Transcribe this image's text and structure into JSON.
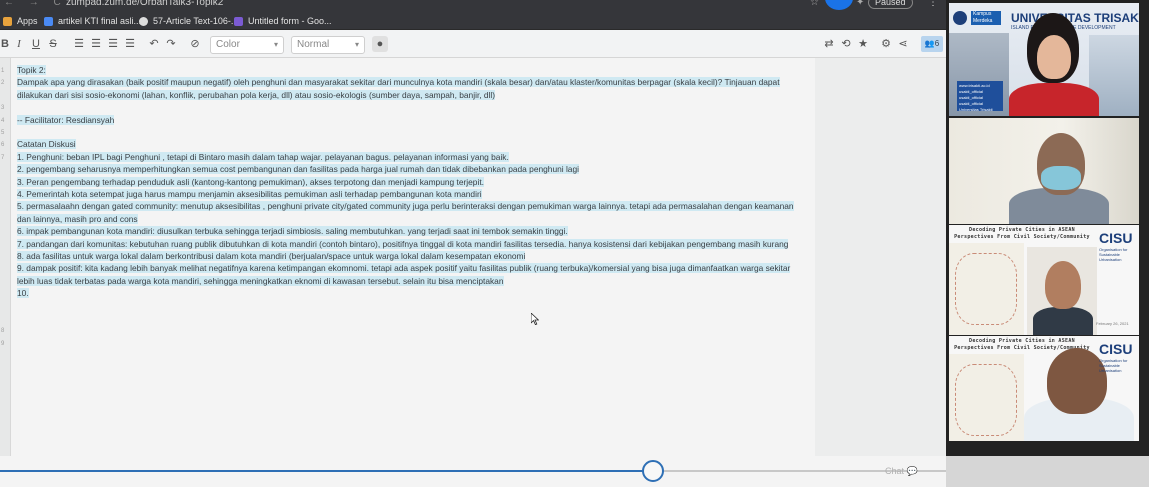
{
  "browser": {
    "url": "zumpad.zum.de/OrbanTalk3-Topik2",
    "paused_label": "Paused",
    "bookmarks": [
      {
        "label": "Apps",
        "icon": "apps-grid-icon",
        "color": "#e8a33d"
      },
      {
        "label": "artikel KTI final asli...",
        "icon": "doc-icon",
        "color": "#4a8af4"
      },
      {
        "label": "57-Article Text-106-...",
        "icon": "globe-icon",
        "color": "#dddddd"
      },
      {
        "label": "Untitled form - Goo...",
        "icon": "form-icon",
        "color": "#7b5bd3"
      }
    ]
  },
  "toolbar": {
    "bold": "B",
    "italic": "I",
    "underline": "U",
    "strike": "S",
    "color_select": "Color",
    "style_select": "Normal",
    "users_count": "6"
  },
  "editor": {
    "line_numbers": [
      "1",
      "2",
      "",
      "3",
      "4",
      "5",
      "6",
      "7",
      "",
      "",
      "",
      "",
      "",
      "",
      "",
      "",
      "",
      "",
      "",
      "",
      "",
      "8",
      "9"
    ],
    "lines": [
      {
        "text": "Topik 2:",
        "hl": true
      },
      {
        "text": "Dampak apa yang dirasakan (baik positif maupun negatif) oleh penghuni dan masyarakat sekitar dari munculnya kota mandiri (skala besar) dan/atau klaster/komunitas berpagar (skala kecil)? Tinjauan dapat dilakukan dari sisi sosio-ekonomi (lahan, konflik, perubahan pola kerja, dll) atau sosio-ekologis (sumber daya, sampah, banjir, dll)",
        "hl": true
      },
      {
        "text": "",
        "hl": false
      },
      {
        "text": "-- Facilitator: Resdiansyah",
        "hl": true
      },
      {
        "text": "",
        "hl": false
      },
      {
        "text": "Catatan Diskusi",
        "hl": true
      },
      {
        "text": "1. Penghuni: beban IPL bagi Penghuni , tetapi di Bintaro masih dalam tahap wajar. pelayanan bagus. pelayanan informasi yang baik.",
        "hl": true
      },
      {
        "text": "2. pengembang seharusnya memperhitungkan semua cost pembangunan dan fasilitas pada harga jual rumah dan tidak dibebankan pada penghuni lagi",
        "hl": true
      },
      {
        "text": "3. Peran pengembang terhadap penduduk asli (kantong-kantong pemukiman), akses terpotong dan menjadi kampung terjepit.",
        "hl": true
      },
      {
        "text": "4. Pemerintah kota setempat juga harus mampu menjamin aksesibilitas pemukiman asli terhadap pembangunan kota mandiri",
        "hl": true
      },
      {
        "text": "5. permasalaahn dengan gated community: menutup aksesibilitas , penghuni private city/gated community juga perlu berinteraksi dengan pemukiman warga lainnya. tetapi ada permasalahan dengan keamanan dan lainnya, masih pro and cons",
        "hl": true
      },
      {
        "text": "6. impak pembangunan kota mandiri: diusulkan terbuka sehingga terjadi simbiosis. saling membutuhkan. yang terjadi saat ini tembok semakin tinggi.",
        "hl": true
      },
      {
        "text": "7. pandangan dari komunitas: kebutuhan ruang publik dibutuhkan di kota mandiri (contoh bintaro), positifnya tinggal di kota mandiri fasilitas tersedia. hanya kosistensi dari kebijakan pengembang masih kurang",
        "hl": true
      },
      {
        "text": "8. ada fasilitas untuk warga lokal dalam berkontribusi dalam kota mandiri (berjualan/space untuk warga lokal dalam kesempatan ekonomi",
        "hl": true
      },
      {
        "text": "9. dampak positif: kita kadang lebih banyak melihat negatifnya karena ketimpangan ekomnomi. tetapi ada aspek positif yaitu fasilitas publik (ruang terbuka)/komersial yang bisa juga dimanfaatkan warga sekitar lebih luas tidak terbatas pada warga kota mandiri, sehingga meningkatkan eknomi di kawasan tersebut. selain itu bisa menciptakan",
        "hl": true
      },
      {
        "text": "10.",
        "hl": true
      }
    ]
  },
  "timeslider": {
    "chat_label": "Chat",
    "progress": 0.69
  },
  "video_panel": {
    "university_title": "UNIVERSITAS TRISAKTI",
    "university_subtitle": "ISLAND FOR SUSTAINABLE DEVELOPMENT",
    "kampus_merdeka": "Kampus Merdeka",
    "social_lines": [
      "www.trisakti.ac.id",
      "usakti_official",
      "usakti_official",
      "usakti_official",
      "Universitas Trisakti"
    ],
    "deck_title": "Decoding Private Cities in ASEAN",
    "deck_subtitle": "Perspectives From Civil Society/Community",
    "cisu": "CISU",
    "cisu_sub": "Organisation for Sustainable Urbanisation",
    "date": "February 26, 2021"
  }
}
